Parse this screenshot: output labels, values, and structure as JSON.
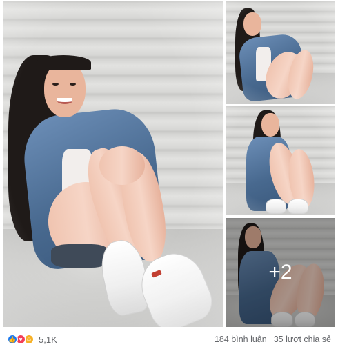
{
  "photos": {
    "more_count": "+2"
  },
  "footer": {
    "reactions": {
      "icons": [
        "like-icon",
        "love-icon",
        "haha-icon"
      ],
      "count": "5,1K"
    },
    "comments": "184 bình luận",
    "shares": "35 lượt chia sẻ"
  },
  "colors": {
    "like": "#1877f2",
    "love": "#f33e58",
    "haha": "#f7b125",
    "meta_text": "#65676b"
  }
}
